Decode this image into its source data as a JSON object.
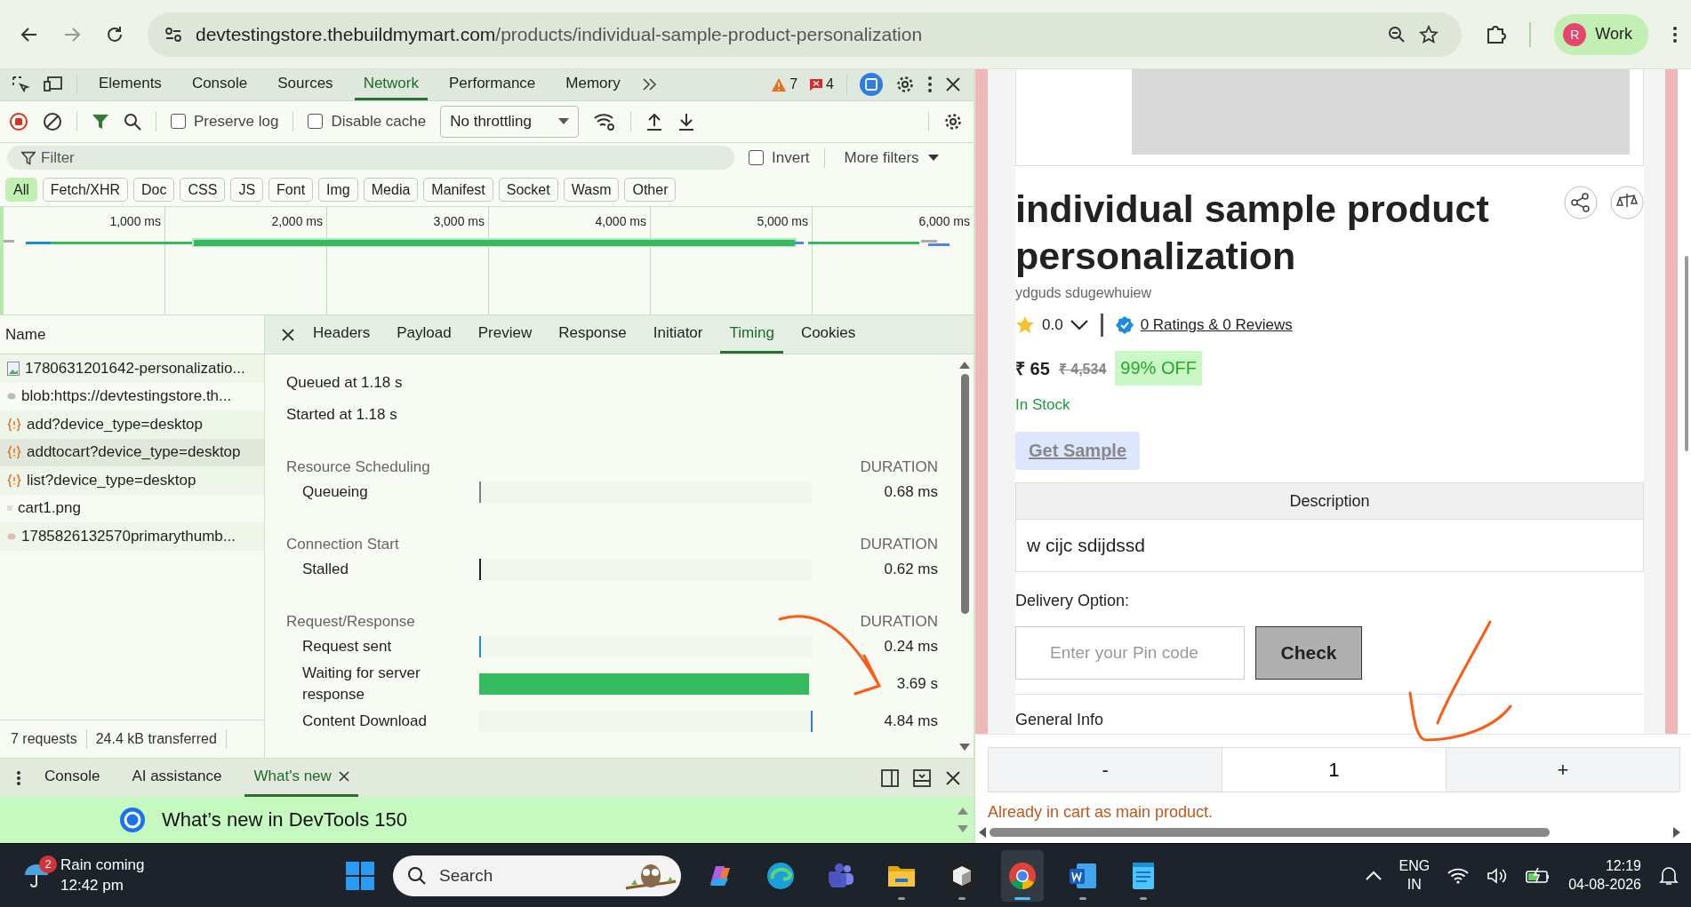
{
  "browser": {
    "url_host": "devtestingstore.thebuildmymart.com",
    "url_path": "/products/individual-sample-product-personalization",
    "profile_initial": "R",
    "profile_label": "Work"
  },
  "devtools": {
    "tabs": [
      {
        "label": "Elements",
        "selected": false
      },
      {
        "label": "Console",
        "selected": false
      },
      {
        "label": "Sources",
        "selected": false
      },
      {
        "label": "Network",
        "selected": true
      },
      {
        "label": "Performance",
        "selected": false
      },
      {
        "label": "Memory",
        "selected": false
      }
    ],
    "warnings": "7",
    "errors": "4",
    "preserve_log": {
      "label": "Preserve log",
      "checked": false
    },
    "disable_cache": {
      "label": "Disable cache",
      "checked": false
    },
    "throttling": "No throttling",
    "filter_placeholder": "Filter",
    "invert": {
      "label": "Invert",
      "checked": false
    },
    "more_filters": "More filters",
    "type_filters": [
      {
        "label": "All",
        "selected": true
      },
      {
        "label": "Fetch/XHR",
        "selected": false
      },
      {
        "label": "Doc",
        "selected": false
      },
      {
        "label": "CSS",
        "selected": false
      },
      {
        "label": "JS",
        "selected": false
      },
      {
        "label": "Font",
        "selected": false
      },
      {
        "label": "Img",
        "selected": false
      },
      {
        "label": "Media",
        "selected": false
      },
      {
        "label": "Manifest",
        "selected": false
      },
      {
        "label": "Socket",
        "selected": false
      },
      {
        "label": "Wasm",
        "selected": false
      },
      {
        "label": "Other",
        "selected": false
      }
    ],
    "overview_ticks": [
      "1,000 ms",
      "2,000 ms",
      "3,000 ms",
      "4,000 ms",
      "5,000 ms",
      "6,000 ms"
    ],
    "requests_header": "Name",
    "requests": [
      {
        "name": "1780631201642-personalizatio...",
        "kind": "image",
        "selected": false
      },
      {
        "name": "blob:https://devtestingstore.th...",
        "kind": "blob",
        "selected": false
      },
      {
        "name": "add?device_type=desktop",
        "kind": "fetch",
        "selected": false
      },
      {
        "name": "addtocart?device_type=desktop",
        "kind": "fetch",
        "selected": true
      },
      {
        "name": "list?device_type=desktop",
        "kind": "fetch",
        "selected": false
      },
      {
        "name": "cart1.png",
        "kind": "blank",
        "selected": false
      },
      {
        "name": "1785826132570primarythumb...",
        "kind": "thumb",
        "selected": false
      }
    ],
    "summary": [
      "7 requests",
      "24.4 kB transferred"
    ],
    "detail_tabs": [
      {
        "label": "Headers",
        "selected": false
      },
      {
        "label": "Payload",
        "selected": false
      },
      {
        "label": "Preview",
        "selected": false
      },
      {
        "label": "Response",
        "selected": false
      },
      {
        "label": "Initiator",
        "selected": false
      },
      {
        "label": "Timing",
        "selected": true
      },
      {
        "label": "Cookies",
        "selected": false
      }
    ],
    "queued": "Queued at 1.18 s",
    "started": "Started at 1.18 s",
    "sections": [
      {
        "title": "Resource Scheduling",
        "duration_label": "DURATION",
        "rows": [
          {
            "label": "Queueing",
            "kind": "start-marker",
            "color": "#808080",
            "value": "0.68 ms"
          }
        ]
      },
      {
        "title": "Connection Start",
        "duration_label": "DURATION",
        "rows": [
          {
            "label": "Stalled",
            "kind": "start-marker",
            "color": "#202020",
            "value": "0.62 ms"
          }
        ]
      },
      {
        "title": "Request/Response",
        "duration_label": "DURATION",
        "rows": [
          {
            "label": "Request sent",
            "kind": "start-marker",
            "color": "#1a8fd0",
            "value": "0.24 ms"
          },
          {
            "label": "Waiting for server response",
            "kind": "bar",
            "color": "#35bb5d",
            "level": 0.99,
            "value": "3.69 s"
          },
          {
            "label": "Content Download",
            "kind": "end-marker",
            "color": "#3a7bd5",
            "value": "4.84 ms"
          }
        ]
      }
    ]
  },
  "drawer": {
    "tabs": [
      {
        "label": "Console",
        "selected": false,
        "closable": false
      },
      {
        "label": "AI assistance",
        "selected": false,
        "closable": false
      },
      {
        "label": "What's new",
        "selected": true,
        "closable": true
      }
    ],
    "heading": "What’s new in DevTools 150"
  },
  "product": {
    "title": "individual sample product personalization",
    "vendor": "ydguds sdugewhuiew",
    "rating": "0.0",
    "reviews_link": "0 Ratings & 0 Reviews",
    "price": "₹ 65",
    "old_price": "₹ 4,534",
    "discount": "99% OFF",
    "stock": "In Stock",
    "sample_button": "Get Sample",
    "description_header": "Description",
    "description": "w cijc sdijdssd",
    "delivery_label": "Delivery Option:",
    "pin_placeholder": "Enter your Pin code",
    "check_button": "Check",
    "general_info": "General Info",
    "qty_minus": "-",
    "qty_value": "1",
    "qty_plus": "+",
    "cart_message": "Already in cart as main product."
  },
  "taskbar": {
    "weather": {
      "badge": "2",
      "title": "Rain coming",
      "subtitle": "12:42 pm"
    },
    "search": "Search",
    "apps": [
      {
        "kind": "copilot",
        "running": false,
        "selected": false
      },
      {
        "kind": "edge",
        "running": false,
        "selected": false
      },
      {
        "kind": "teams",
        "running": false,
        "selected": false
      },
      {
        "kind": "folder",
        "running": true,
        "selected": false
      },
      {
        "kind": "cube",
        "running": true,
        "selected": false
      },
      {
        "kind": "chrome",
        "running": true,
        "selected": true
      },
      {
        "kind": "word",
        "running": true,
        "selected": false
      },
      {
        "kind": "notepad",
        "running": true,
        "selected": false
      }
    ],
    "lang": "ENG",
    "region": "IN",
    "time": "12:19",
    "date": "04-08-2026"
  }
}
